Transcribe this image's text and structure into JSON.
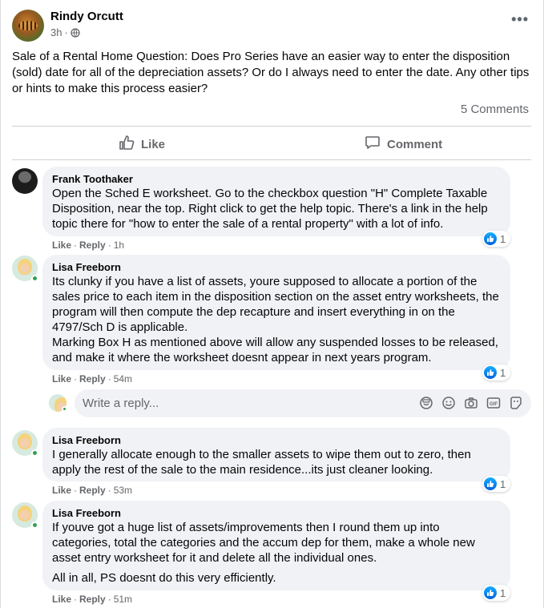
{
  "post": {
    "author": "Rindy Orcutt",
    "time": "3h",
    "separator": "·",
    "text": "Sale of a Rental Home Question: Does Pro Series have an easier way to enter the disposition (sold) date for all of the depreciation assets? Or do I always need to enter the date. Any other tips or hints to make this process easier?",
    "comment_count": "5 Comments",
    "like_label": "Like",
    "comment_label": "Comment",
    "more_label": "•••"
  },
  "comments": [
    {
      "name": "Frank Toothaker",
      "text": "Open the Sched E worksheet. Go to the checkbox question \"H\" Complete Taxable Disposition, near the top. Right click to get the help topic. There's a link in the help topic there for \"how to enter the sale of a rental property\" with a lot of info.",
      "like": "Like",
      "reply": "Reply",
      "time": "1h",
      "reactions": "1"
    },
    {
      "name": "Lisa Freeborn",
      "text": "Its clunky if you have a list of assets, youre supposed to allocate a portion of the sales price to each item in the disposition section on the asset entry worksheets, the program will then compute the dep recapture and insert everything in on the 4797/Sch D is applicable.",
      "text2": "Marking Box H as mentioned above will allow any suspended losses to be released, and make it where the worksheet doesnt appear in next years program.",
      "like": "Like",
      "reply": "Reply",
      "time": "54m",
      "reactions": "1"
    },
    {
      "name": "Lisa Freeborn",
      "text": "I generally allocate enough to the smaller assets to wipe them out to zero, then apply the rest of the sale to the main residence...its just cleaner looking.",
      "like": "Like",
      "reply": "Reply",
      "time": "53m",
      "reactions": "1"
    },
    {
      "name": "Lisa Freeborn",
      "text": "If youve got a huge list of assets/improvements then I round them up into categories, total the categories and the accum dep for them, make a whole new asset entry worksheet for it and delete all the individual ones.",
      "text2": "All in all, PS doesnt do this very efficiently.",
      "like": "Like",
      "reply": "Reply",
      "time": "51m",
      "reactions": "1"
    }
  ],
  "reply_box": {
    "placeholder": "Write a reply..."
  },
  "icons": [
    "globe-icon",
    "more-icon",
    "like-icon",
    "comment-icon",
    "sticker-icon",
    "emoji-icon",
    "camera-icon",
    "gif-icon",
    "avatar-sticker-icon"
  ],
  "colors": {
    "accent": "#1877f2",
    "bubble": "#f0f2f5",
    "muted": "#65676b",
    "online": "#31a24c"
  }
}
